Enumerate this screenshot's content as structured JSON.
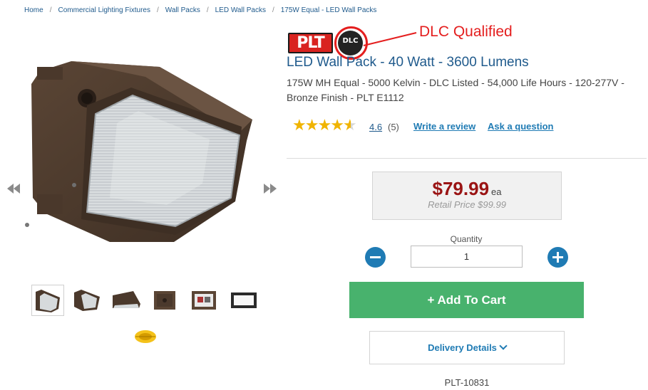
{
  "breadcrumb": {
    "items": [
      "Home",
      "Commercial Lighting Fixtures",
      "Wall Packs",
      "LED Wall Packs",
      "175W Equal - LED Wall Packs"
    ],
    "separator": "/"
  },
  "brand": {
    "plt_logo_text": "PLT",
    "dlc_logo_text": "DLC",
    "annotation": "DLC Qualified",
    "annotation_color": "#e41e1e"
  },
  "product": {
    "title": "LED Wall Pack - 40 Watt - 3600 Lumens",
    "subtitle": "175W MH Equal - 5000 Kelvin - DLC Listed - 54,000 Life Hours - 120-277V - Bronze Finish - PLT E1112",
    "sku": "PLT-10831"
  },
  "rating": {
    "stars": 4.6,
    "value": "4.6",
    "count": "(5)",
    "write_review": "Write a review",
    "ask_question": "Ask a question"
  },
  "price": {
    "amount": "$79.99",
    "unit": "ea",
    "retail": "Retail Price $99.99",
    "color": "#9a1414"
  },
  "quantity": {
    "label": "Quantity",
    "value": "1",
    "minus_icon": "minus-circle-icon",
    "plus_icon": "plus-circle-icon"
  },
  "actions": {
    "add_to_cart": "+ Add To Cart",
    "add_to_cart_color": "#48b26d",
    "delivery": "Delivery Details"
  },
  "gallery": {
    "prev_icon": "double-left-arrow-icon",
    "next_icon": "double-right-arrow-icon",
    "thumbnail_count": 7
  }
}
